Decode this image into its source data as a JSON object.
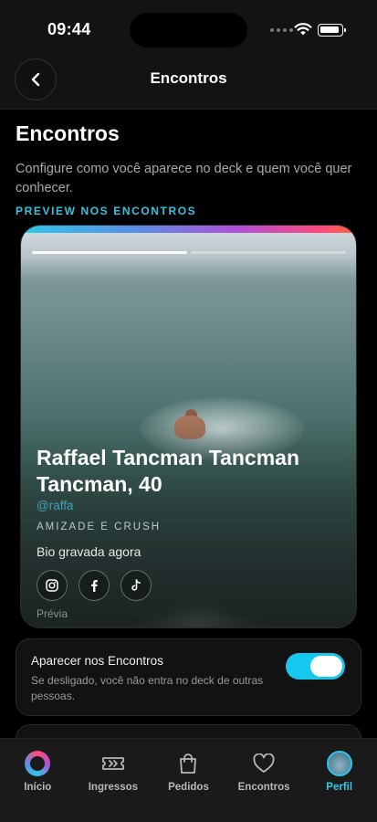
{
  "status": {
    "time": "09:44"
  },
  "header": {
    "title": "Encontros"
  },
  "intro": {
    "title": "Encontros",
    "description": "Configure como você aparece no deck e quem você quer conhecer.",
    "section_label": "PREVIEW NOS ENCONTROS"
  },
  "preview": {
    "name": "Raffael Tancman Tancman Tancman, 40",
    "handle": "@raffa",
    "tags": "AMIZADE E CRUSH",
    "bio": "Bio gravada agora",
    "socials": [
      "instagram-icon",
      "facebook-icon",
      "tiktok-icon"
    ],
    "caption": "Prévia"
  },
  "setting": {
    "title": "Aparecer nos Encontros",
    "description": "Se desligado, você não entra no deck de outras pessoas.",
    "enabled": true
  },
  "tabs": [
    {
      "label": "Início",
      "icon": "app-logo-icon",
      "active": false
    },
    {
      "label": "Ingressos",
      "icon": "ticket-icon",
      "active": false
    },
    {
      "label": "Pedidos",
      "icon": "shopping-bag-icon",
      "active": false
    },
    {
      "label": "Encontros",
      "icon": "heart-icon",
      "active": false
    },
    {
      "label": "Perfil",
      "icon": "avatar-icon",
      "active": true
    }
  ],
  "colors": {
    "accent": "#2ec6ea",
    "toggle_on": "#17c8ee"
  }
}
